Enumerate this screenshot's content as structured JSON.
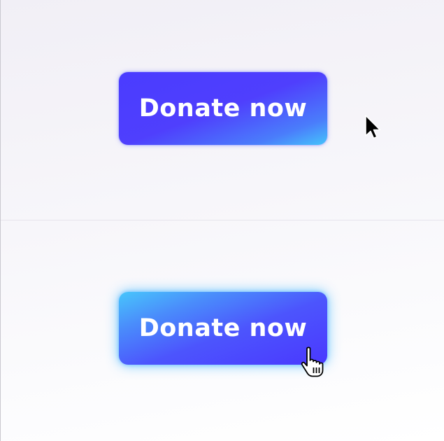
{
  "states": {
    "default": {
      "button_label": "Donate now",
      "cursor_icon": "arrow-pointer-icon"
    },
    "hover": {
      "button_label": "Donate now",
      "cursor_icon": "hand-pointer-icon"
    }
  },
  "colors": {
    "button_primary": "#4a3cff",
    "button_accent": "#45c4fb",
    "hover_glow": "#50beff",
    "label": "#ffffff",
    "background": "#f5f4f9"
  }
}
